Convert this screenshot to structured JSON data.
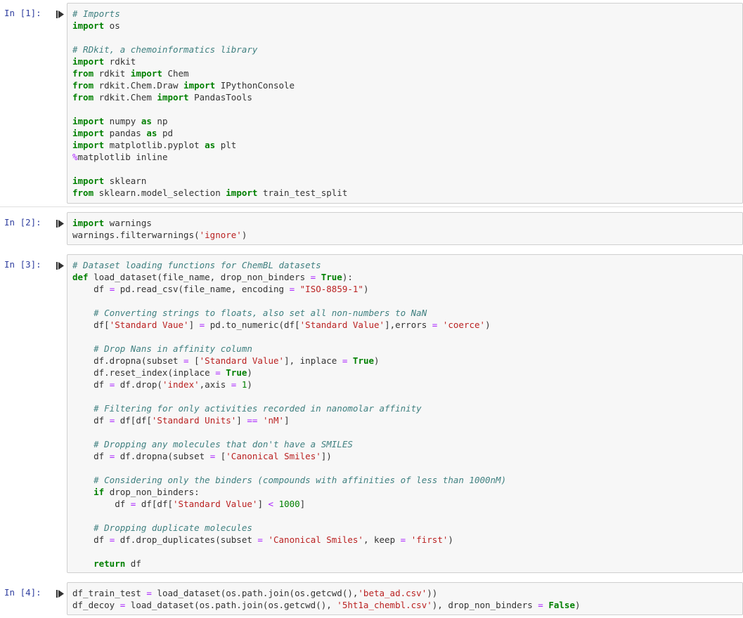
{
  "cells": [
    {
      "prompt": "In [1]:",
      "lines": [
        [
          [
            "cm",
            "# Imports"
          ]
        ],
        [
          [
            "kw",
            "import"
          ],
          [
            "tx",
            " os"
          ]
        ],
        [],
        [
          [
            "cm",
            "# RDkit, a chemoinformatics library"
          ]
        ],
        [
          [
            "kw",
            "import"
          ],
          [
            "tx",
            " rdkit"
          ]
        ],
        [
          [
            "kw",
            "from"
          ],
          [
            "tx",
            " rdkit "
          ],
          [
            "kw",
            "import"
          ],
          [
            "tx",
            " Chem"
          ]
        ],
        [
          [
            "kw",
            "from"
          ],
          [
            "tx",
            " rdkit.Chem.Draw "
          ],
          [
            "kw",
            "import"
          ],
          [
            "tx",
            " IPythonConsole"
          ]
        ],
        [
          [
            "kw",
            "from"
          ],
          [
            "tx",
            " rdkit.Chem "
          ],
          [
            "kw",
            "import"
          ],
          [
            "tx",
            " PandasTools"
          ]
        ],
        [],
        [
          [
            "kw",
            "import"
          ],
          [
            "tx",
            " numpy "
          ],
          [
            "kw",
            "as"
          ],
          [
            "tx",
            " np"
          ]
        ],
        [
          [
            "kw",
            "import"
          ],
          [
            "tx",
            " pandas "
          ],
          [
            "kw",
            "as"
          ],
          [
            "tx",
            " pd"
          ]
        ],
        [
          [
            "kw",
            "import"
          ],
          [
            "tx",
            " matplotlib.pyplot "
          ],
          [
            "kw",
            "as"
          ],
          [
            "tx",
            " plt"
          ]
        ],
        [
          [
            "mg",
            "%"
          ],
          [
            "tx",
            "matplotlib inline"
          ]
        ],
        [],
        [
          [
            "kw",
            "import"
          ],
          [
            "tx",
            " sklearn"
          ]
        ],
        [
          [
            "kw",
            "from"
          ],
          [
            "tx",
            " sklearn.model_selection "
          ],
          [
            "kw",
            "import"
          ],
          [
            "tx",
            " train_test_split"
          ]
        ]
      ]
    },
    {
      "prompt": "In [2]:",
      "lines": [
        [
          [
            "kw",
            "import"
          ],
          [
            "tx",
            " warnings"
          ]
        ],
        [
          [
            "tx",
            "warnings.filterwarnings("
          ],
          [
            "st",
            "'ignore'"
          ],
          [
            "tx",
            ")"
          ]
        ]
      ]
    },
    {
      "prompt": "In [3]:",
      "lines": [
        [
          [
            "cm",
            "# Dataset loading functions for ChemBL datasets"
          ]
        ],
        [
          [
            "kw",
            "def"
          ],
          [
            "tx",
            " load_dataset(file_name, drop_non_binders "
          ],
          [
            "op",
            "="
          ],
          [
            "tx",
            " "
          ],
          [
            "kw",
            "True"
          ],
          [
            "tx",
            "):"
          ]
        ],
        [
          [
            "tx",
            "    df "
          ],
          [
            "op",
            "="
          ],
          [
            "tx",
            " pd.read_csv(file_name, encoding "
          ],
          [
            "op",
            "="
          ],
          [
            "tx",
            " "
          ],
          [
            "st",
            "\"ISO-8859-1\""
          ],
          [
            "tx",
            ")"
          ]
        ],
        [],
        [
          [
            "tx",
            "    "
          ],
          [
            "cm",
            "# Converting strings to floats, also set all non-numbers to NaN"
          ]
        ],
        [
          [
            "tx",
            "    df["
          ],
          [
            "st",
            "'Standard Vaue'"
          ],
          [
            "tx",
            "] "
          ],
          [
            "op",
            "="
          ],
          [
            "tx",
            " pd.to_numeric(df["
          ],
          [
            "st",
            "'Standard Value'"
          ],
          [
            "tx",
            "],errors "
          ],
          [
            "op",
            "="
          ],
          [
            "tx",
            " "
          ],
          [
            "st",
            "'coerce'"
          ],
          [
            "tx",
            ")"
          ]
        ],
        [],
        [
          [
            "tx",
            "    "
          ],
          [
            "cm",
            "# Drop Nans in affinity column"
          ]
        ],
        [
          [
            "tx",
            "    df.dropna(subset "
          ],
          [
            "op",
            "="
          ],
          [
            "tx",
            " ["
          ],
          [
            "st",
            "'Standard Value'"
          ],
          [
            "tx",
            "], inplace "
          ],
          [
            "op",
            "="
          ],
          [
            "tx",
            " "
          ],
          [
            "kw",
            "True"
          ],
          [
            "tx",
            ")"
          ]
        ],
        [
          [
            "tx",
            "    df.reset_index(inplace "
          ],
          [
            "op",
            "="
          ],
          [
            "tx",
            " "
          ],
          [
            "kw",
            "True"
          ],
          [
            "tx",
            ")"
          ]
        ],
        [
          [
            "tx",
            "    df "
          ],
          [
            "op",
            "="
          ],
          [
            "tx",
            " df.drop("
          ],
          [
            "st",
            "'index'"
          ],
          [
            "tx",
            ",axis "
          ],
          [
            "op",
            "="
          ],
          [
            "tx",
            " "
          ],
          [
            "nu",
            "1"
          ],
          [
            "tx",
            ")"
          ]
        ],
        [],
        [
          [
            "tx",
            "    "
          ],
          [
            "cm",
            "# Filtering for only activities recorded in nanomolar affinity"
          ]
        ],
        [
          [
            "tx",
            "    df "
          ],
          [
            "op",
            "="
          ],
          [
            "tx",
            " df[df["
          ],
          [
            "st",
            "'Standard Units'"
          ],
          [
            "tx",
            "] "
          ],
          [
            "op",
            "=="
          ],
          [
            "tx",
            " "
          ],
          [
            "st",
            "'nM'"
          ],
          [
            "tx",
            "]"
          ]
        ],
        [],
        [
          [
            "tx",
            "    "
          ],
          [
            "cm",
            "# Dropping any molecules that don't have a SMILES"
          ]
        ],
        [
          [
            "tx",
            "    df "
          ],
          [
            "op",
            "="
          ],
          [
            "tx",
            " df.dropna(subset "
          ],
          [
            "op",
            "="
          ],
          [
            "tx",
            " ["
          ],
          [
            "st",
            "'Canonical Smiles'"
          ],
          [
            "tx",
            "])"
          ]
        ],
        [],
        [
          [
            "tx",
            "    "
          ],
          [
            "cm",
            "# Considering only the binders (compounds with affinities of less than 1000nM)"
          ]
        ],
        [
          [
            "tx",
            "    "
          ],
          [
            "kw",
            "if"
          ],
          [
            "tx",
            " drop_non_binders:"
          ]
        ],
        [
          [
            "tx",
            "        df "
          ],
          [
            "op",
            "="
          ],
          [
            "tx",
            " df[df["
          ],
          [
            "st",
            "'Standard Value'"
          ],
          [
            "tx",
            "] "
          ],
          [
            "op",
            "<"
          ],
          [
            "tx",
            " "
          ],
          [
            "nu",
            "1000"
          ],
          [
            "tx",
            "]"
          ]
        ],
        [],
        [
          [
            "tx",
            "    "
          ],
          [
            "cm",
            "# Dropping duplicate molecules"
          ]
        ],
        [
          [
            "tx",
            "    df "
          ],
          [
            "op",
            "="
          ],
          [
            "tx",
            " df.drop_duplicates(subset "
          ],
          [
            "op",
            "="
          ],
          [
            "tx",
            " "
          ],
          [
            "st",
            "'Canonical Smiles'"
          ],
          [
            "tx",
            ", keep "
          ],
          [
            "op",
            "="
          ],
          [
            "tx",
            " "
          ],
          [
            "st",
            "'first'"
          ],
          [
            "tx",
            ")"
          ]
        ],
        [],
        [
          [
            "tx",
            "    "
          ],
          [
            "kw",
            "return"
          ],
          [
            "tx",
            " df"
          ]
        ]
      ]
    },
    {
      "prompt": "In [4]:",
      "lines": [
        [
          [
            "tx",
            "df_train_test "
          ],
          [
            "op",
            "="
          ],
          [
            "tx",
            " load_dataset(os.path.join(os.getcwd(),"
          ],
          [
            "st",
            "'beta_ad.csv'"
          ],
          [
            "tx",
            "))"
          ]
        ],
        [
          [
            "tx",
            "df_decoy "
          ],
          [
            "op",
            "="
          ],
          [
            "tx",
            " load_dataset(os.path.join(os.getcwd(), "
          ],
          [
            "st",
            "'5ht1a_chembl.csv'"
          ],
          [
            "tx",
            "), drop_non_binders "
          ],
          [
            "op",
            "="
          ],
          [
            "tx",
            " "
          ],
          [
            "kw",
            "False"
          ],
          [
            "tx",
            ")"
          ]
        ]
      ]
    }
  ],
  "run_icon": "run-cell-icon",
  "colors": {
    "prompt": "#303f9f",
    "keyword": "#008000",
    "comment": "#408080",
    "string": "#ba2121",
    "operator": "#aa22ff",
    "cell_bg": "#f7f7f7",
    "cell_border": "#cfcfcf"
  }
}
